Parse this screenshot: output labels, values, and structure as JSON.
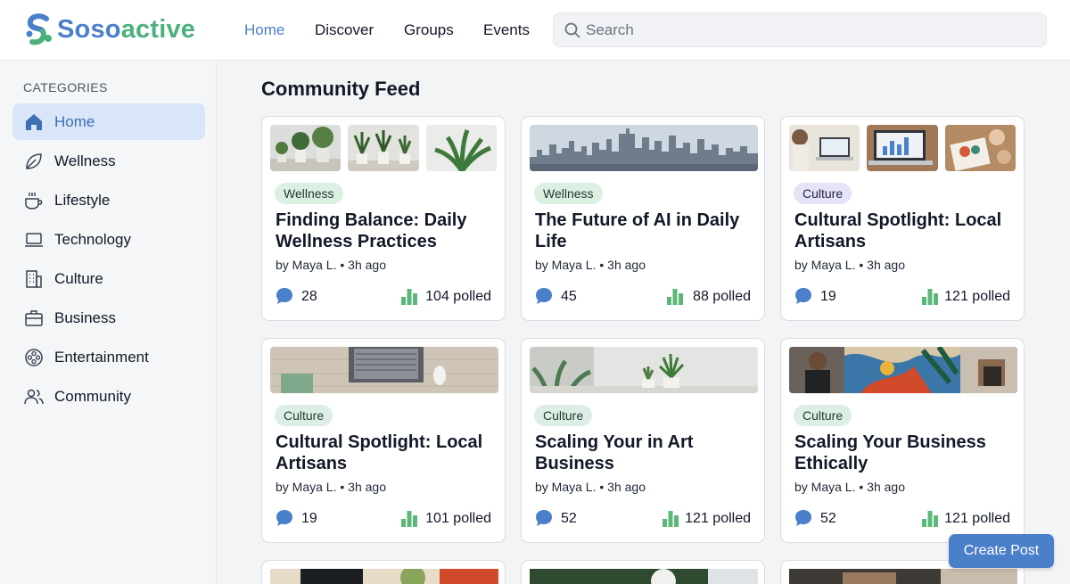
{
  "header": {
    "brand_part1": "Soso",
    "brand_part2": "active",
    "nav": [
      "Home",
      "Discover",
      "Groups",
      "Events"
    ],
    "active_nav": "Home",
    "search_placeholder": "Search"
  },
  "sidebar": {
    "heading": "CATEGORIES",
    "items": [
      {
        "label": "Home",
        "icon": "home-icon"
      },
      {
        "label": "Wellness",
        "icon": "leaf-icon"
      },
      {
        "label": "Lifestyle",
        "icon": "coffee-cup-icon"
      },
      {
        "label": "Technology",
        "icon": "laptop-icon"
      },
      {
        "label": "Culture",
        "icon": "building-icon"
      },
      {
        "label": "Business",
        "icon": "briefcase-icon"
      },
      {
        "label": "Entertainment",
        "icon": "film-reel-icon"
      },
      {
        "label": "Community",
        "icon": "people-icon"
      }
    ]
  },
  "main": {
    "feed_title": "Community Feed",
    "cards": [
      {
        "tag": "Wellness",
        "title": "Finding Balance: Daily Wellness Practices",
        "meta": "by Maya L. • 3h ago",
        "comments": "28",
        "polled": "104 polled"
      },
      {
        "tag": "Wellness",
        "title": "The Future of AI in Daily Life",
        "meta": "by Maya L. • 3h ago",
        "comments": "45",
        "polled": "88 polled"
      },
      {
        "tag": "Culture",
        "title": "Cultural Spotlight: Local Artisans",
        "meta": "by Maya L. • 3h ago",
        "comments": "19",
        "polled": "121 polled"
      },
      {
        "tag": "Culture",
        "title": "Cultural Spotlight: Local Artisans",
        "meta": "by Maya L. • 3h ago",
        "comments": "19",
        "polled": "101 polled"
      },
      {
        "tag": "Culture",
        "title": "Scaling Your in Art Business",
        "meta": "by Maya L. • 3h ago",
        "comments": "52",
        "polled": "121 polled"
      },
      {
        "tag": "Culture",
        "title": "Scaling Your Business Ethically",
        "meta": "by Maya L. • 3h ago",
        "comments": "52",
        "polled": "121 polled"
      }
    ],
    "create_button": "Create Post"
  },
  "colors": {
    "accent": "#4a7fc9",
    "brand_green": "#4cb07c",
    "poll_green": "#5cb87a",
    "active_bg": "#d9e5f8"
  }
}
